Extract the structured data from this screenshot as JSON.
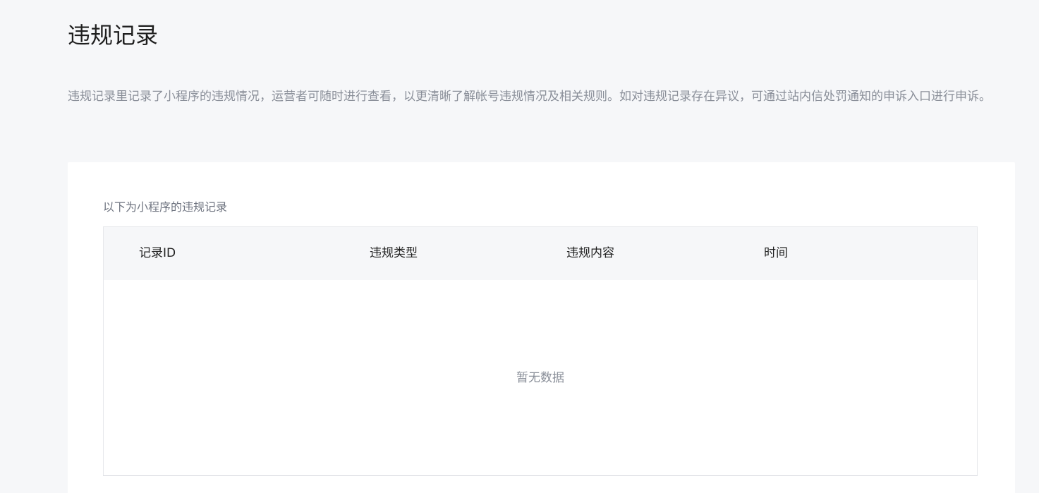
{
  "page": {
    "title": "违规记录",
    "description": "违规记录里记录了小程序的违规情况，运营者可随时进行查看，以更清晰了解帐号违规情况及相关规则。如对违规记录存在异议，可通过站内信处罚通知的申诉入口进行申诉。"
  },
  "records": {
    "caption": "以下为小程序的违规记录",
    "columns": [
      "记录ID",
      "违规类型",
      "违规内容",
      "时间"
    ],
    "rows": [],
    "empty_text": "暂无数据"
  }
}
